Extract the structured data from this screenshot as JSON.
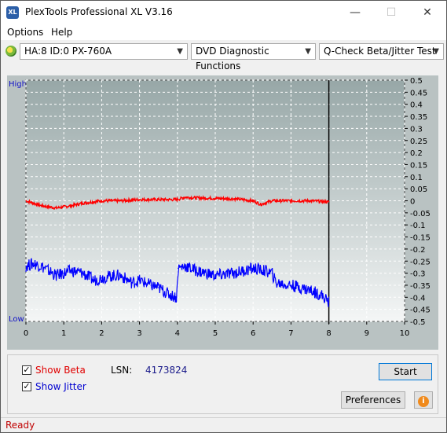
{
  "window": {
    "title": "PlexTools Professional XL V3.16",
    "app_icon_text": "XL"
  },
  "menu": {
    "options": "Options",
    "help": "Help"
  },
  "toolbar": {
    "drive": "HA:8 ID:0  PX-760A",
    "function": "DVD Diagnostic Functions",
    "test": "Q-Check Beta/Jitter Test"
  },
  "chart_data": {
    "type": "line",
    "y_left_labels": [
      "High",
      "Low"
    ],
    "x_ticks": [
      0,
      1,
      2,
      3,
      4,
      5,
      6,
      7,
      8,
      9,
      10
    ],
    "y_right_ticks": [
      "0.5",
      "0.45",
      "0.4",
      "0.35",
      "0.3",
      "0.25",
      "0.2",
      "0.15",
      "0.1",
      "0.05",
      "0",
      "-0.05",
      "-0.1",
      "-0.15",
      "-0.2",
      "-0.25",
      "-0.3",
      "-0.35",
      "-0.4",
      "-0.45",
      "-0.5"
    ],
    "xlim": [
      0,
      10
    ],
    "ylim": [
      -0.5,
      0.5
    ],
    "end_marker_x": 8,
    "series": [
      {
        "color": "#ff0000",
        "x": [
          0,
          0.2,
          0.4,
          0.6,
          0.8,
          1.0,
          1.2,
          1.5,
          2.0,
          2.5,
          3.0,
          3.5,
          4.0,
          4.2,
          4.5,
          5.0,
          5.5,
          6.0,
          6.2,
          6.5,
          7.0,
          7.5,
          8.0
        ],
        "y": [
          0.0,
          -0.01,
          -0.02,
          -0.025,
          -0.03,
          -0.025,
          -0.02,
          -0.01,
          0.0,
          0.0,
          0.005,
          0.005,
          0.005,
          0.015,
          0.012,
          0.01,
          0.008,
          0.0,
          -0.015,
          0.0,
          0.0,
          0.0,
          -0.005
        ]
      },
      {
        "color": "#0000ff",
        "x": [
          0,
          0.2,
          0.4,
          0.6,
          0.8,
          1.0,
          1.2,
          1.5,
          1.8,
          2.0,
          2.3,
          2.5,
          2.8,
          3.0,
          3.3,
          3.5,
          3.8,
          3.98,
          4.02,
          4.2,
          4.5,
          5.0,
          5.5,
          6.0,
          6.3,
          6.5,
          6.6,
          7.0,
          7.5,
          7.8,
          8.0
        ],
        "y": [
          -0.27,
          -0.26,
          -0.27,
          -0.29,
          -0.31,
          -0.3,
          -0.29,
          -0.3,
          -0.33,
          -0.32,
          -0.31,
          -0.31,
          -0.34,
          -0.33,
          -0.35,
          -0.36,
          -0.39,
          -0.4,
          -0.28,
          -0.27,
          -0.29,
          -0.31,
          -0.3,
          -0.28,
          -0.29,
          -0.3,
          -0.34,
          -0.35,
          -0.37,
          -0.39,
          -0.42
        ]
      }
    ]
  },
  "panel": {
    "show_beta": "Show Beta",
    "show_jitter": "Show Jitter",
    "lsn_label": "LSN:",
    "lsn_value": "4173824",
    "start": "Start",
    "preferences": "Preferences"
  },
  "status": {
    "text": "Ready"
  }
}
